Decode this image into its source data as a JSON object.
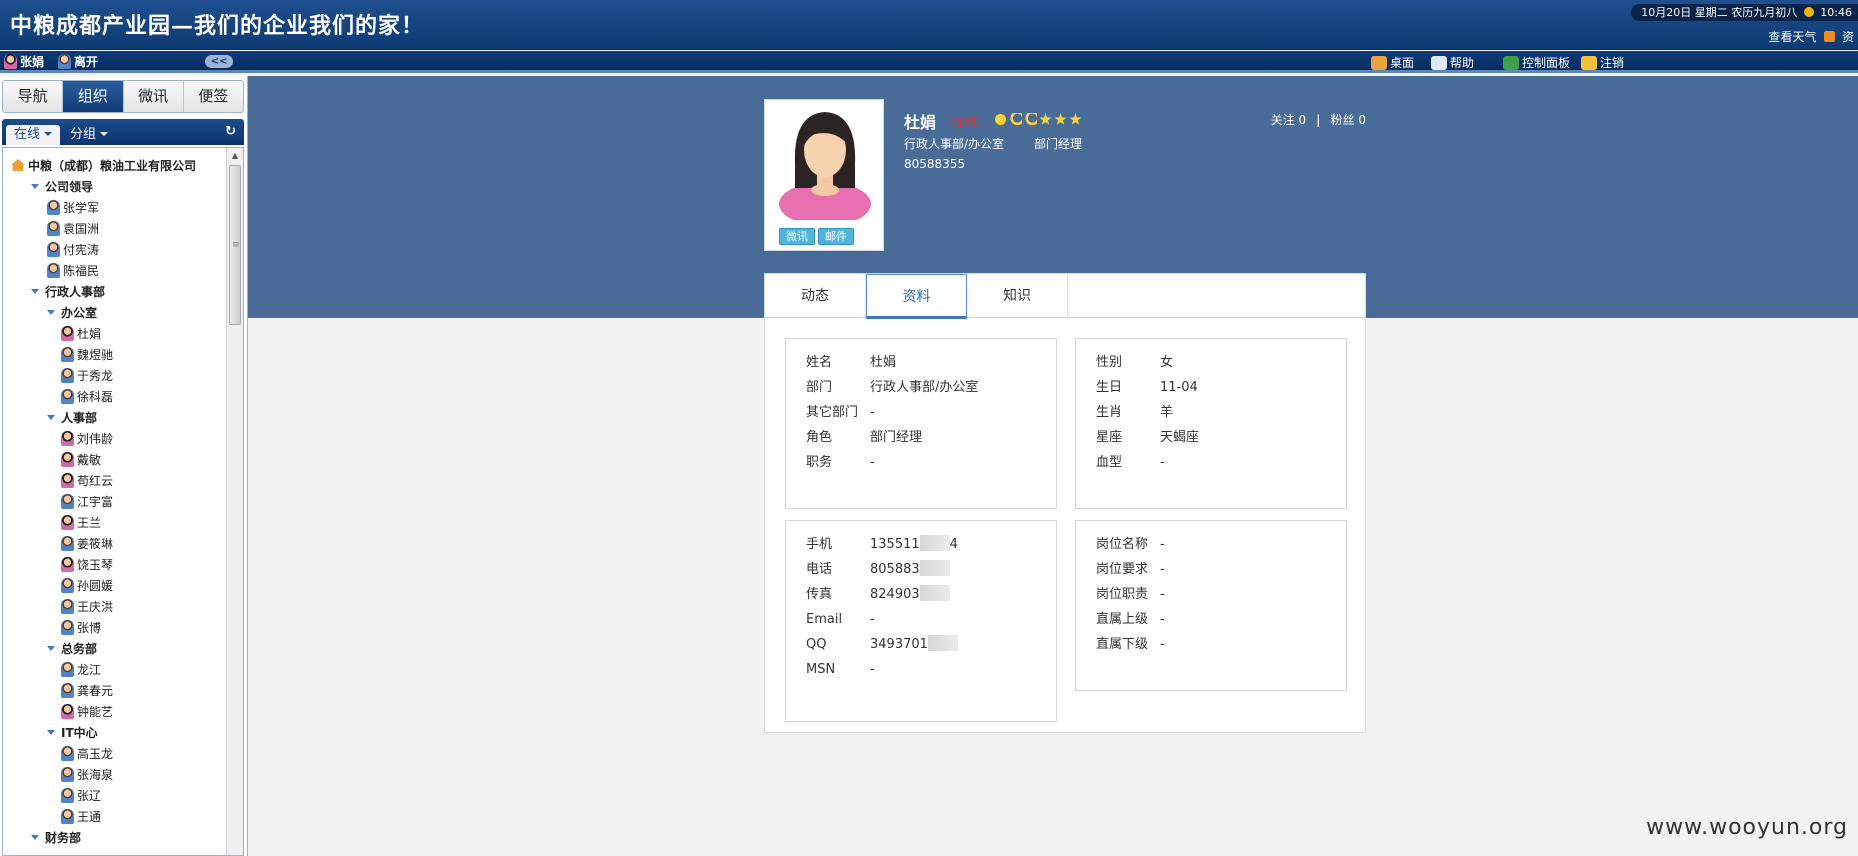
{
  "header": {
    "title": "中粮成都产业园—我们的企业我们的家！",
    "date_text": "10月20日 星期二 农历九月初八",
    "time": "10:46",
    "weather_label": "查看天气",
    "rss_label": "资"
  },
  "userbar": {
    "user1": "张娟",
    "user2": "离开",
    "collapse_label": "<<",
    "links": [
      {
        "label": "桌面",
        "color": "#e8a33a"
      },
      {
        "label": "帮助",
        "color": "#e0e8f4"
      },
      {
        "label": "控制面板",
        "color": "#3ea04c"
      },
      {
        "label": "注销",
        "color": "#f4c23a"
      }
    ]
  },
  "sidebar": {
    "tabs": [
      "导航",
      "组织",
      "微讯",
      "便签"
    ],
    "active_tab": 1,
    "filters": [
      "在线",
      "分组"
    ],
    "refresh_icon": "↻",
    "tree": [
      {
        "label": "中粮（成都）粮油工业有限公司",
        "level": 0,
        "type": "org"
      },
      {
        "label": "公司领导",
        "level": 1,
        "type": "group"
      },
      {
        "label": "张学军",
        "level": 2,
        "type": "m"
      },
      {
        "label": "袁国洲",
        "level": 2,
        "type": "m"
      },
      {
        "label": "付宪涛",
        "level": 2,
        "type": "m"
      },
      {
        "label": "陈福民",
        "level": 2,
        "type": "m"
      },
      {
        "label": "行政人事部",
        "level": 1,
        "type": "group"
      },
      {
        "label": "办公室",
        "level": 2,
        "type": "group"
      },
      {
        "label": "杜娟",
        "level": 3,
        "type": "f"
      },
      {
        "label": "魏煜驰",
        "level": 3,
        "type": "m"
      },
      {
        "label": "于秀龙",
        "level": 3,
        "type": "m"
      },
      {
        "label": "徐科磊",
        "level": 3,
        "type": "m"
      },
      {
        "label": "人事部",
        "level": 2,
        "type": "group"
      },
      {
        "label": "刘伟龄",
        "level": 3,
        "type": "f"
      },
      {
        "label": "戴敏",
        "level": 3,
        "type": "f"
      },
      {
        "label": "苟红云",
        "level": 3,
        "type": "f"
      },
      {
        "label": "江宇富",
        "level": 3,
        "type": "m"
      },
      {
        "label": "王兰",
        "level": 3,
        "type": "f"
      },
      {
        "label": "姜筱琳",
        "level": 3,
        "type": "m"
      },
      {
        "label": "饶玉琴",
        "level": 3,
        "type": "f"
      },
      {
        "label": "孙圆媛",
        "level": 3,
        "type": "m"
      },
      {
        "label": "王庆洪",
        "level": 3,
        "type": "m"
      },
      {
        "label": "张博",
        "level": 3,
        "type": "m"
      },
      {
        "label": "总务部",
        "level": 2,
        "type": "group"
      },
      {
        "label": "龙江",
        "level": 3,
        "type": "m"
      },
      {
        "label": "龚春元",
        "level": 3,
        "type": "m"
      },
      {
        "label": "钟能艺",
        "level": 3,
        "type": "f"
      },
      {
        "label": "IT中心",
        "level": 2,
        "type": "group"
      },
      {
        "label": "高玉龙",
        "level": 3,
        "type": "m"
      },
      {
        "label": "张海泉",
        "level": 3,
        "type": "m"
      },
      {
        "label": "张辽",
        "level": 3,
        "type": "m"
      },
      {
        "label": "王通",
        "level": 3,
        "type": "m"
      },
      {
        "label": "财务部",
        "level": 1,
        "type": "group"
      }
    ]
  },
  "profile": {
    "name": "杜娟",
    "status": "(在线)",
    "level_icons": [
      "sun-icon",
      "moon-icon",
      "moon-icon",
      "star-icon",
      "star-icon",
      "star-icon"
    ],
    "department": "行政人事部/办公室",
    "role": "部门经理",
    "phone": "80588355",
    "weixun_button": "微讯",
    "email_button": "邮件",
    "follow_label": "关注 0",
    "fans_label": "粉丝 0",
    "sep": "|"
  },
  "tabs": [
    "动态",
    "资料",
    "知识"
  ],
  "active_tab": 1,
  "info": {
    "basic": [
      {
        "k": "姓名",
        "v": "杜娟"
      },
      {
        "k": "部门",
        "v": "行政人事部/办公室"
      },
      {
        "k": "其它部门",
        "v": "-"
      },
      {
        "k": "角色",
        "v": "部门经理"
      },
      {
        "k": "职务",
        "v": "-"
      }
    ],
    "personal": [
      {
        "k": "性别",
        "v": "女"
      },
      {
        "k": "生日",
        "v": "11-04"
      },
      {
        "k": "生肖",
        "v": "羊"
      },
      {
        "k": "星座",
        "v": "天蝎座"
      },
      {
        "k": "血型",
        "v": "-"
      }
    ],
    "contact": [
      {
        "k": "手机",
        "v": "135511",
        "tail": "4"
      },
      {
        "k": "电话",
        "v": "805883"
      },
      {
        "k": "传真",
        "v": "824903"
      },
      {
        "k": "Email",
        "v": "-"
      },
      {
        "k": "QQ",
        "v": "3493701"
      },
      {
        "k": "MSN",
        "v": "-"
      }
    ],
    "position": [
      {
        "k": "岗位名称",
        "v": "-"
      },
      {
        "k": "岗位要求",
        "v": "-"
      },
      {
        "k": "岗位职责",
        "v": "-"
      },
      {
        "k": "直属上级",
        "v": "-"
      },
      {
        "k": "直属下级",
        "v": "-"
      }
    ]
  },
  "watermark": "www.wooyun.org"
}
